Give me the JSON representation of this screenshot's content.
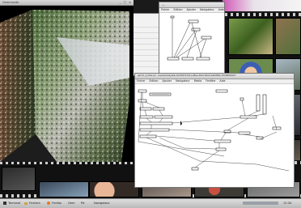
{
  "video_window": {
    "title": "Gemmonde",
    "buttons": "_ □ ×"
  },
  "small_patch_window": {
    "title": "—",
    "menu": [
      "Fichier",
      "Édition",
      "Ajouter",
      "Navigateur",
      "Media",
      "Fenêtre",
      "Aide"
    ]
  },
  "main_patch_window": {
    "title": "gemm_4_filter.pd - /media/cblaj/disk-DCCE974153-e-f8ee-40a3-b910-2e6df09b-1f6/NEW4567",
    "menu": [
      "Fichier",
      "Édition",
      "Ajouter",
      "Navigateur",
      "Media",
      "Fenêtre",
      "Aide"
    ],
    "objects": [
      "pix_video",
      "gemhead",
      "pix_texture",
      "rectangle 4 3",
      "translateXYZ",
      "rotateXYZ",
      "t b b",
      "metro 40",
      "f",
      "+ 1",
      "mod 360",
      "s rot",
      "r rot",
      "gemwin",
      "create, 1",
      "destroy"
    ]
  },
  "taskbar": {
    "items": [
      "Terminal",
      "Fichiers",
      "Firefox",
      "Gem",
      "Pd",
      "Navigateur"
    ],
    "clock": "12:34"
  },
  "colors": {
    "window_bg": "#ffffff",
    "film_bg": "#111111",
    "taskbar": "#c8c8c8",
    "pink_accent": "#d257b8"
  }
}
